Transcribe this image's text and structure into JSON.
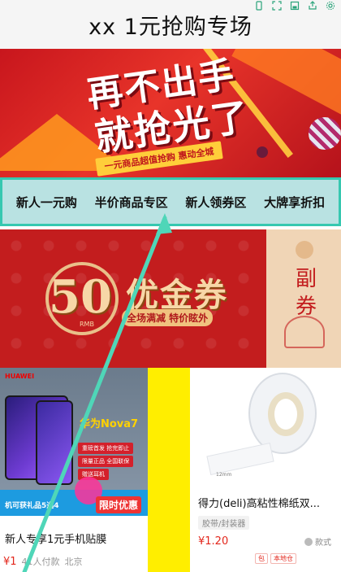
{
  "header": {
    "title": "xx 1元抢购专场"
  },
  "toolbar": {
    "icons": [
      "phone-icon",
      "expand-icon",
      "save-icon",
      "share-icon",
      "settings-icon"
    ]
  },
  "banner": {
    "headline_line1": "再不出手",
    "headline_line2": "就抢光了",
    "subline": "一元商品超值抢购 惠动全城"
  },
  "category_nav": {
    "items": [
      {
        "label": "新人一元购"
      },
      {
        "label": "半价商品专区"
      },
      {
        "label": "新人领券区"
      },
      {
        "label": "大牌享折扣"
      }
    ],
    "border_color": "#36c8b0",
    "background_color": "#b9e2e2"
  },
  "coupon_banner": {
    "amount": "50",
    "currency": "RMB",
    "title": "优金券",
    "pill": "全场满减 特价眩外",
    "side_label": "副券"
  },
  "products": [
    {
      "brand": "HUAWEI",
      "model": "华为Nova7",
      "promo_tags": [
        "重磅首发 抢完即止",
        "限量正品 全国联保",
        "赠送耳机"
      ],
      "gift_text": "机可获礼品5选4",
      "limit_badge": "限时优惠",
      "name": "新人专享1元手机贴膜",
      "price": "¥1",
      "payers": "41人付款",
      "location": "北京"
    },
    {
      "name": "得力(deli)高粘性棉纸双...",
      "category": "胶带/封装器",
      "price": "¥1.20",
      "style_label": "款式",
      "measure": "12mm",
      "badges": [
        "包",
        "本地仓"
      ]
    }
  ],
  "colors": {
    "price_red": "#e3271c",
    "accent_teal": "#36c8b0",
    "strip_yellow": "#ffee00"
  }
}
